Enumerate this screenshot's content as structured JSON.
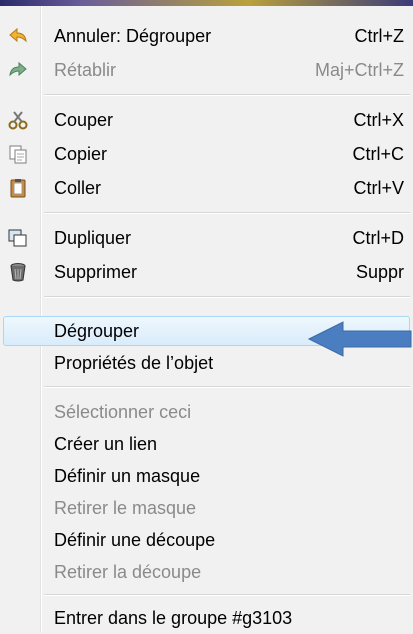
{
  "menu": {
    "items": [
      {
        "label": "Annuler: Dégrouper",
        "shortcut": "Ctrl+Z",
        "icon": "undo-icon"
      },
      {
        "label": "Rétablir",
        "shortcut": "Maj+Ctrl+Z",
        "icon": "redo-icon"
      },
      {
        "label": "Couper",
        "shortcut": "Ctrl+X",
        "icon": "scissors-icon"
      },
      {
        "label": "Copier",
        "shortcut": "Ctrl+C",
        "icon": "copy-icon"
      },
      {
        "label": "Coller",
        "shortcut": "Ctrl+V",
        "icon": "paste-icon"
      },
      {
        "label": "Dupliquer",
        "shortcut": "Ctrl+D",
        "icon": "duplicate-icon"
      },
      {
        "label": "Supprimer",
        "shortcut": "Suppr",
        "icon": "trash-icon"
      },
      {
        "label": "Dégrouper"
      },
      {
        "label": "Propriétés de l’objet"
      },
      {
        "label": "Sélectionner ceci"
      },
      {
        "label": "Créer un lien"
      },
      {
        "label": "Définir un masque"
      },
      {
        "label": "Retirer le masque"
      },
      {
        "label": "Définir une découpe"
      },
      {
        "label": "Retirer la découpe"
      },
      {
        "label": "Entrer dans le groupe #g3103"
      }
    ]
  },
  "colors": {
    "highlight_border": "#a8d8f5",
    "arrow": "#4a7ec0",
    "disabled_text": "#8a8a8a"
  }
}
